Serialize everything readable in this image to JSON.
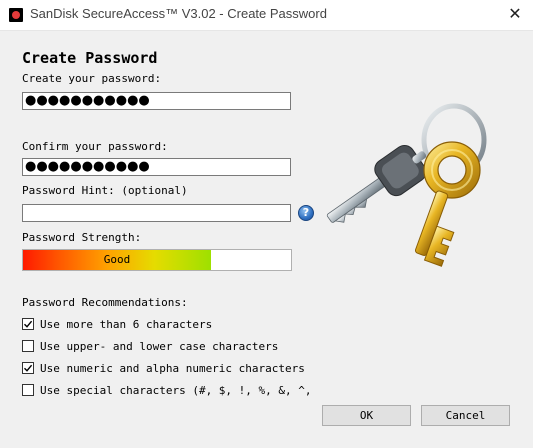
{
  "window": {
    "title": "SanDisk SecureAccess™ V3.02 - Create Password",
    "close_glyph": "✕"
  },
  "form": {
    "heading": "Create Password",
    "create_label": "Create your password:",
    "create_value": "●●●●●●●●●●●",
    "confirm_label": "Confirm your password:",
    "confirm_value": "●●●●●●●●●●●",
    "hint_label": "Password Hint: (optional)",
    "hint_value": "",
    "help_glyph": "?"
  },
  "strength": {
    "label": "Password Strength:",
    "text": "Good",
    "level_fraction": 0.7
  },
  "recommendations": {
    "heading": "Password Recommendations:",
    "items": [
      {
        "label": "Use more than 6 characters",
        "checked": true
      },
      {
        "label": "Use upper- and lower case characters",
        "checked": false
      },
      {
        "label": "Use numeric and alpha numeric characters",
        "checked": true
      },
      {
        "label": "Use special characters (#, $, !, %, &, ^,",
        "checked": false
      }
    ]
  },
  "buttons": {
    "ok": "OK",
    "cancel": "Cancel"
  },
  "icons": {
    "app": "sandisk-app-icon",
    "help": "help-icon",
    "keys": "keys-illustration"
  },
  "colors": {
    "window_bg": "#f0f0f0",
    "help_blue": "#2f6fc0",
    "key_gold": "#e2b024",
    "key_silver": "#9aa5ad"
  }
}
